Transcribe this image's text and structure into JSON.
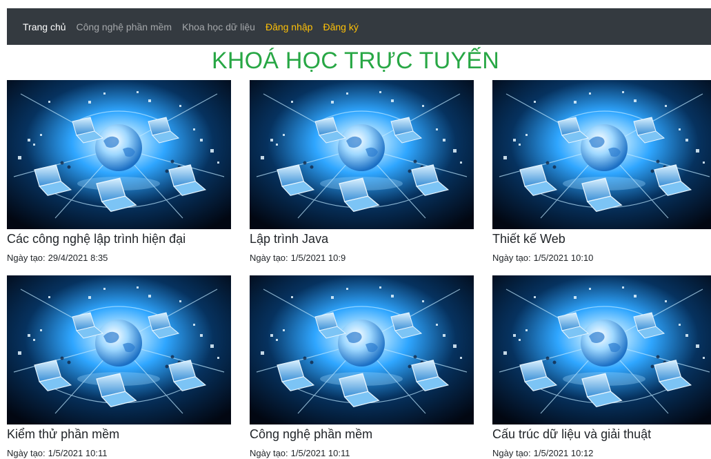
{
  "nav": {
    "items": [
      {
        "label": "Trang chủ",
        "style": "brand"
      },
      {
        "label": "Công nghệ phần mềm",
        "style": "muted"
      },
      {
        "label": "Khoa học dữ liệu",
        "style": "muted"
      },
      {
        "label": "Đăng nhập",
        "style": "accent"
      },
      {
        "label": "Đăng ký",
        "style": "accent"
      }
    ]
  },
  "page": {
    "title": "KHOÁ HỌC TRỰC TUYẾN"
  },
  "date_label": "Ngày tạo:",
  "courses": [
    {
      "title": "Các công nghệ lập trình hiện đại",
      "date": "29/4/2021 8:35"
    },
    {
      "title": "Lập trình Java",
      "date": "1/5/2021 10:9"
    },
    {
      "title": "Thiết kế Web",
      "date": "1/5/2021 10:10"
    },
    {
      "title": "Kiểm thử phần mềm",
      "date": "1/5/2021 10:11"
    },
    {
      "title": "Công nghệ phần mềm",
      "date": "1/5/2021 10:11"
    },
    {
      "title": "Cấu trúc dữ liệu và giải thuật",
      "date": "1/5/2021 10:12"
    }
  ],
  "colors": {
    "navbar_bg": "#343a40",
    "nav_accent": "#ffc107",
    "title_green": "#28a745",
    "thumbnail_glow": "#2fa6ff"
  },
  "icons": {
    "thumbnail": "network-globe-laptops-illustration"
  }
}
